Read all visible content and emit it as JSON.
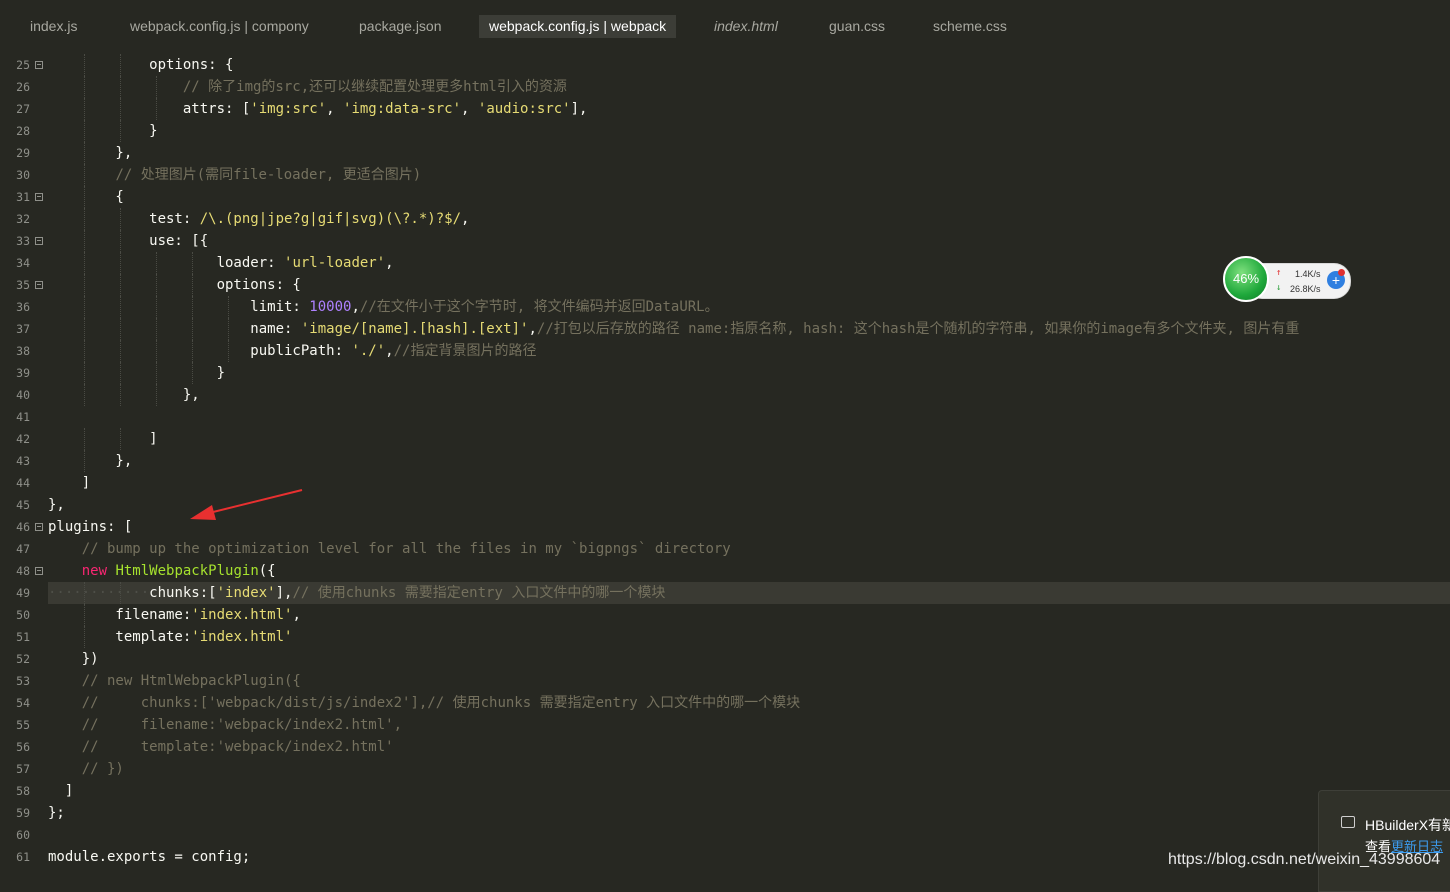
{
  "tabs": [
    {
      "label": "index.js",
      "active": false,
      "italic": false
    },
    {
      "label": "webpack.config.js | compony",
      "active": false,
      "italic": false
    },
    {
      "label": "package.json",
      "active": false,
      "italic": false
    },
    {
      "label": "webpack.config.js | webpack",
      "active": true,
      "italic": false
    },
    {
      "label": "index.html",
      "active": false,
      "italic": true
    },
    {
      "label": "guan.css",
      "active": false,
      "italic": false
    },
    {
      "label": "scheme.css",
      "active": false,
      "italic": false
    }
  ],
  "colors": {
    "background": "#272822",
    "comment": "#75715e",
    "string": "#e6db74",
    "number": "#ae81ff",
    "keyword": "#f92672",
    "function": "#a6e22e",
    "arrow": "#e83030"
  },
  "lines": [
    {
      "n": "25",
      "fold": true,
      "tokens": [
        [
          "p",
          "            options: {"
        ]
      ]
    },
    {
      "n": "26",
      "fold": false,
      "tokens": [
        [
          "p",
          "                "
        ],
        [
          "c",
          "// 除了img的src,还可以继续配置处理更多html引入的资源"
        ]
      ]
    },
    {
      "n": "27",
      "fold": false,
      "tokens": [
        [
          "p",
          "                attrs: ["
        ],
        [
          "s",
          "'img:src'"
        ],
        [
          "p",
          ", "
        ],
        [
          "s",
          "'img:data-src'"
        ],
        [
          "p",
          ", "
        ],
        [
          "s",
          "'audio:src'"
        ],
        [
          "p",
          "],"
        ]
      ]
    },
    {
      "n": "28",
      "fold": false,
      "tokens": [
        [
          "p",
          "            }"
        ]
      ]
    },
    {
      "n": "29",
      "fold": false,
      "tokens": [
        [
          "p",
          "        },"
        ]
      ]
    },
    {
      "n": "30",
      "fold": false,
      "tokens": [
        [
          "p",
          "        "
        ],
        [
          "c",
          "// 处理图片(需同file-loader, 更适合图片)"
        ]
      ]
    },
    {
      "n": "31",
      "fold": true,
      "tokens": [
        [
          "p",
          "        {"
        ]
      ]
    },
    {
      "n": "32",
      "fold": false,
      "tokens": [
        [
          "p",
          "            test: "
        ],
        [
          "s",
          "/\\.(png|jpe?g|gif|svg)(\\?.*)?$/"
        ],
        [
          "p",
          ","
        ]
      ]
    },
    {
      "n": "33",
      "fold": true,
      "tokens": [
        [
          "p",
          "            use: [{"
        ]
      ]
    },
    {
      "n": "34",
      "fold": false,
      "tokens": [
        [
          "p",
          "                    loader: "
        ],
        [
          "s",
          "'url-loader'"
        ],
        [
          "p",
          ","
        ]
      ]
    },
    {
      "n": "35",
      "fold": true,
      "tokens": [
        [
          "p",
          "                    options: {"
        ]
      ]
    },
    {
      "n": "36",
      "fold": false,
      "tokens": [
        [
          "p",
          "                        limit: "
        ],
        [
          "n",
          "10000"
        ],
        [
          "p",
          ","
        ],
        [
          "c",
          "//在文件小于这个字节时, 将文件编码并返回DataURL。"
        ]
      ]
    },
    {
      "n": "37",
      "fold": false,
      "tokens": [
        [
          "p",
          "                        name: "
        ],
        [
          "s",
          "'image/[name].[hash].[ext]'"
        ],
        [
          "p",
          ","
        ],
        [
          "c",
          "//打包以后存放的路径 name:指原名称, hash: 这个hash是个随机的字符串, 如果你的image有多个文件夹, 图片有重"
        ]
      ]
    },
    {
      "n": "38",
      "fold": false,
      "tokens": [
        [
          "p",
          "                        publicPath: "
        ],
        [
          "s",
          "'./'"
        ],
        [
          "p",
          ","
        ],
        [
          "c",
          "//指定背景图片的路径"
        ]
      ]
    },
    {
      "n": "39",
      "fold": false,
      "tokens": [
        [
          "p",
          "                    }"
        ]
      ]
    },
    {
      "n": "40",
      "fold": false,
      "tokens": [
        [
          "p",
          "                },"
        ]
      ]
    },
    {
      "n": "41",
      "fold": false,
      "tokens": []
    },
    {
      "n": "42",
      "fold": false,
      "tokens": [
        [
          "p",
          "            ]"
        ]
      ]
    },
    {
      "n": "43",
      "fold": false,
      "tokens": [
        [
          "p",
          "        },"
        ]
      ]
    },
    {
      "n": "44",
      "fold": false,
      "tokens": [
        [
          "p",
          "    ]"
        ]
      ]
    },
    {
      "n": "45",
      "fold": false,
      "tokens": [
        [
          "p",
          "},"
        ]
      ]
    },
    {
      "n": "46",
      "fold": true,
      "tokens": [
        [
          "p",
          "plugins: ["
        ]
      ]
    },
    {
      "n": "47",
      "fold": false,
      "tokens": [
        [
          "p",
          "    "
        ],
        [
          "c",
          "// bump up the optimization level for all the files in my `bigpngs` directory"
        ]
      ]
    },
    {
      "n": "48",
      "fold": true,
      "tokens": [
        [
          "p",
          "    "
        ],
        [
          "k",
          "new"
        ],
        [
          "p",
          " "
        ],
        [
          "f",
          "HtmlWebpackPlugin"
        ],
        [
          "p",
          "({"
        ]
      ]
    },
    {
      "n": "49",
      "fold": false,
      "highlight": true,
      "tokens": [
        [
          "ws",
          "············"
        ],
        [
          "p",
          "chunks:["
        ],
        [
          "s",
          "'index'"
        ],
        [
          "p",
          "],"
        ],
        [
          "c",
          "// 使用chunks 需要指定entry 入口文件中的哪一个模块"
        ]
      ]
    },
    {
      "n": "50",
      "fold": false,
      "tokens": [
        [
          "p",
          "        filename:"
        ],
        [
          "s",
          "'index.html'"
        ],
        [
          "p",
          ","
        ]
      ]
    },
    {
      "n": "51",
      "fold": false,
      "tokens": [
        [
          "p",
          "        template:"
        ],
        [
          "s",
          "'index.html'"
        ]
      ]
    },
    {
      "n": "52",
      "fold": false,
      "tokens": [
        [
          "p",
          "    })"
        ]
      ]
    },
    {
      "n": "53",
      "fold": false,
      "tokens": [
        [
          "p",
          "    "
        ],
        [
          "c",
          "// new HtmlWebpackPlugin({"
        ]
      ]
    },
    {
      "n": "54",
      "fold": false,
      "tokens": [
        [
          "p",
          "    "
        ],
        [
          "c",
          "//     chunks:['webpack/dist/js/index2'],// 使用chunks 需要指定entry 入口文件中的哪一个模块"
        ]
      ]
    },
    {
      "n": "55",
      "fold": false,
      "tokens": [
        [
          "p",
          "    "
        ],
        [
          "c",
          "//     filename:'webpack/index2.html',"
        ]
      ]
    },
    {
      "n": "56",
      "fold": false,
      "tokens": [
        [
          "p",
          "    "
        ],
        [
          "c",
          "//     template:'webpack/index2.html'"
        ]
      ]
    },
    {
      "n": "57",
      "fold": false,
      "tokens": [
        [
          "p",
          "    "
        ],
        [
          "c",
          "// })"
        ]
      ]
    },
    {
      "n": "58",
      "fold": false,
      "tokens": [
        [
          "p",
          "  ]"
        ]
      ]
    },
    {
      "n": "59",
      "fold": false,
      "tokens": [
        [
          "p",
          "};"
        ]
      ]
    },
    {
      "n": "60",
      "fold": false,
      "tokens": []
    },
    {
      "n": "61",
      "fold": false,
      "tokens": [
        [
          "p",
          "module.exports = config;"
        ]
      ]
    }
  ],
  "network_widget": {
    "percent": "46%",
    "upload": "1.4K/s",
    "download": "26.8K/s",
    "up_icon": "arrow-up-icon",
    "down_icon": "arrow-down-icon",
    "plus_icon": "plus-icon"
  },
  "notification": {
    "title": "HBuilderX有新",
    "body_prefix": "查看",
    "link": "更新日志",
    "icon": "chat-icon"
  },
  "watermark": "https://blog.csdn.net/weixin_43998604"
}
